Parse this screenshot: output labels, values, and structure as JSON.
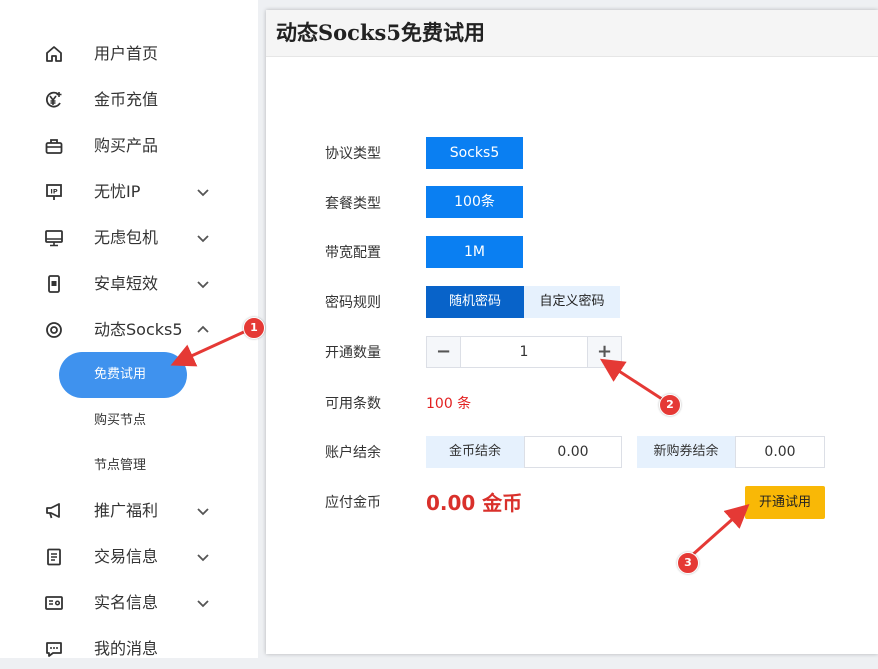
{
  "sidebar": {
    "items": [
      {
        "label": "用户首页",
        "icon": "home-icon"
      },
      {
        "label": "金币充值",
        "icon": "yen-coin-icon"
      },
      {
        "label": "购买产品",
        "icon": "shopping-bag-icon"
      },
      {
        "label": "无忧IP",
        "icon": "ip-icon"
      },
      {
        "label": "无虑包机",
        "icon": "monitor-icon"
      },
      {
        "label": "安卓短效",
        "icon": "mobile-icon"
      },
      {
        "label": "动态Socks5",
        "icon": "target-icon"
      },
      {
        "label": "推广福利",
        "icon": "megaphone-icon"
      },
      {
        "label": "交易信息",
        "icon": "document-icon"
      },
      {
        "label": "实名信息",
        "icon": "id-card-icon"
      },
      {
        "label": "我的消息",
        "icon": "message-icon"
      }
    ],
    "sub_items": [
      "免费试用",
      "购买节点",
      "节点管理"
    ]
  },
  "panel": {
    "title": "动态Socks5免费试用",
    "protocol": {
      "label": "协议类型",
      "value": "Socks5"
    },
    "package": {
      "label": "套餐类型",
      "value": "100条"
    },
    "bandwidth": {
      "label": "带宽配置",
      "value": "1M"
    },
    "password": {
      "label": "密码规则",
      "options": [
        "随机密码",
        "自定义密码"
      ],
      "selected": "随机密码"
    },
    "quantity": {
      "label": "开通数量",
      "value": "1",
      "minus": "−",
      "plus": "+"
    },
    "available": {
      "label": "可用条数",
      "value": "100 条"
    },
    "balance": {
      "label": "账户结余",
      "coin_label": "金币结余",
      "coin_value": "0.00",
      "voucher_label": "新购券结余",
      "voucher_value": "0.00"
    },
    "payable": {
      "label": "应付金币",
      "value": "0.00 金币"
    },
    "open_button": "开通试用"
  },
  "annotations": [
    "1",
    "2",
    "3"
  ],
  "colors": {
    "primary": "#0a7ff2",
    "primary_dark": "#0863c9",
    "sub_active": "#3f92ee",
    "warn": "#f9b806",
    "price": "#d9302b",
    "badge": "#e53935"
  }
}
